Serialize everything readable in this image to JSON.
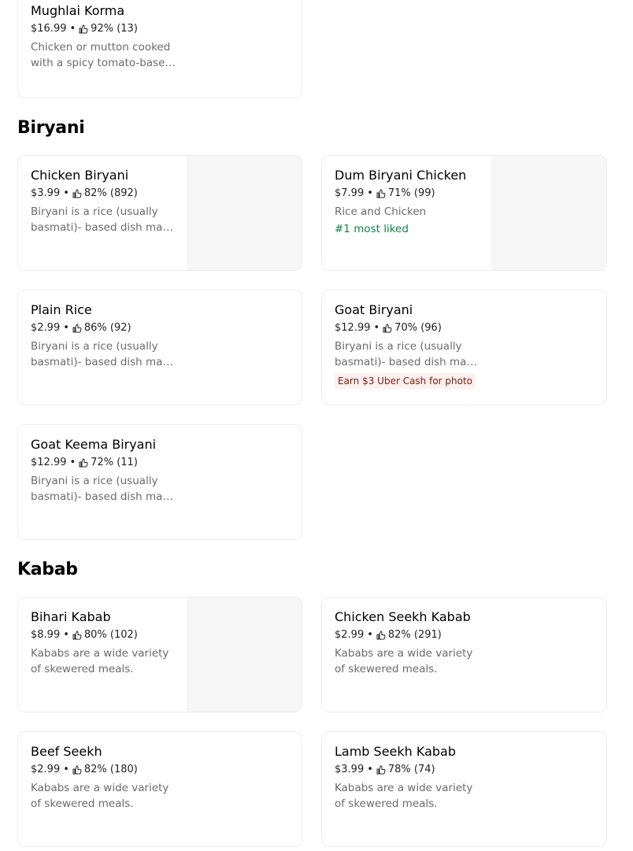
{
  "sections": {
    "prev_item": {
      "name": "Mughlai Korma",
      "price": "$16.99",
      "rating": "92% (13)",
      "desc": "Chicken or mutton cooked with a spicy tomato-based gravy"
    },
    "biryani": {
      "title": "Biryani",
      "items": [
        {
          "name": "Chicken Biryani",
          "price": "$3.99",
          "rating": "82% (892)",
          "desc": "Biryani is a rice (usually basmati)- based dish made with spices"
        },
        {
          "name": "Dum Biryani Chicken",
          "price": "$7.99",
          "rating": "71% (99)",
          "desc": "Rice and Chicken",
          "tag": "#1 most liked"
        },
        {
          "name": "Plain Rice",
          "price": "$2.99",
          "rating": "86% (92)",
          "desc": "Biryani is a rice (usually basmati)- based dish made with spices"
        },
        {
          "name": "Goat Biryani",
          "price": "$12.99",
          "rating": "70% (96)",
          "desc": "Biryani is a rice (usually basmati)- based dish made with spices",
          "badge": "Earn $3 Uber Cash for photo"
        },
        {
          "name": "Goat Keema Biryani",
          "price": "$12.99",
          "rating": "72% (11)",
          "desc": "Biryani is a rice (usually basmati)- based dish made with spices"
        }
      ]
    },
    "kabab": {
      "title": "Kabab",
      "items": [
        {
          "name": "Bihari Kabab",
          "price": "$8.99",
          "rating": "80% (102)",
          "desc": "Kababs are a wide variety of skewered meals."
        },
        {
          "name": "Chicken Seekh Kabab",
          "price": "$2.99",
          "rating": "82% (291)",
          "desc": "Kababs are a wide variety of skewered meals."
        },
        {
          "name": "Beef Seekh",
          "price": "$2.99",
          "rating": "82% (180)",
          "desc": "Kababs are a wide variety of skewered meals."
        },
        {
          "name": "Lamb Seekh Kabab",
          "price": "$3.99",
          "rating": "78% (74)",
          "desc": "Kababs are a wide variety of skewered meals."
        }
      ]
    }
  },
  "separator": "•",
  "icons": {
    "rating": "thumbs-up-icon"
  },
  "colors": {
    "liked": "#0e8345",
    "badge_bg": "#fdf0ee",
    "badge_text": "#7a1c11"
  }
}
